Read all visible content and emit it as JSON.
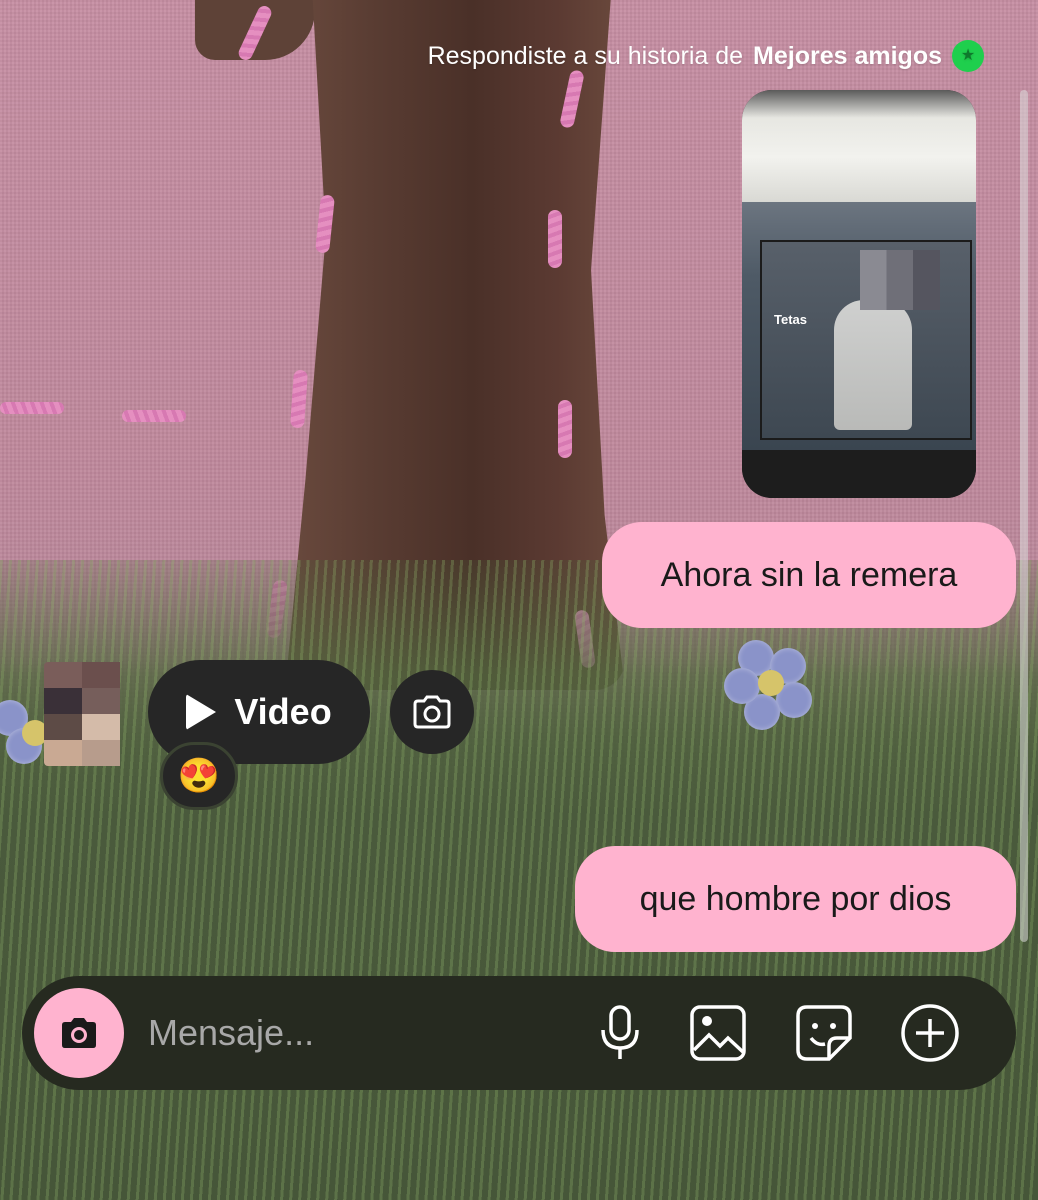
{
  "story_reply": {
    "prefix": "Respondiste a su historia de",
    "audience": "Mejores amigos",
    "audience_icon": "star-icon",
    "thumbnail_caption": "Tetas"
  },
  "messages": [
    {
      "from": "me",
      "text": "Ahora sin la remera"
    },
    {
      "from": "them",
      "type": "video",
      "label": "Video",
      "reaction": "😍"
    },
    {
      "from": "me",
      "text": "que hombre por dios"
    }
  ],
  "composer": {
    "placeholder": "Mensaje...",
    "icons": [
      "camera-icon",
      "microphone-icon",
      "gallery-icon",
      "sticker-icon",
      "plus-icon"
    ]
  },
  "colors": {
    "outgoing_bubble": "#ffb3cf",
    "dark_pill": "#262626",
    "best_friends": "#1fcf4d"
  }
}
